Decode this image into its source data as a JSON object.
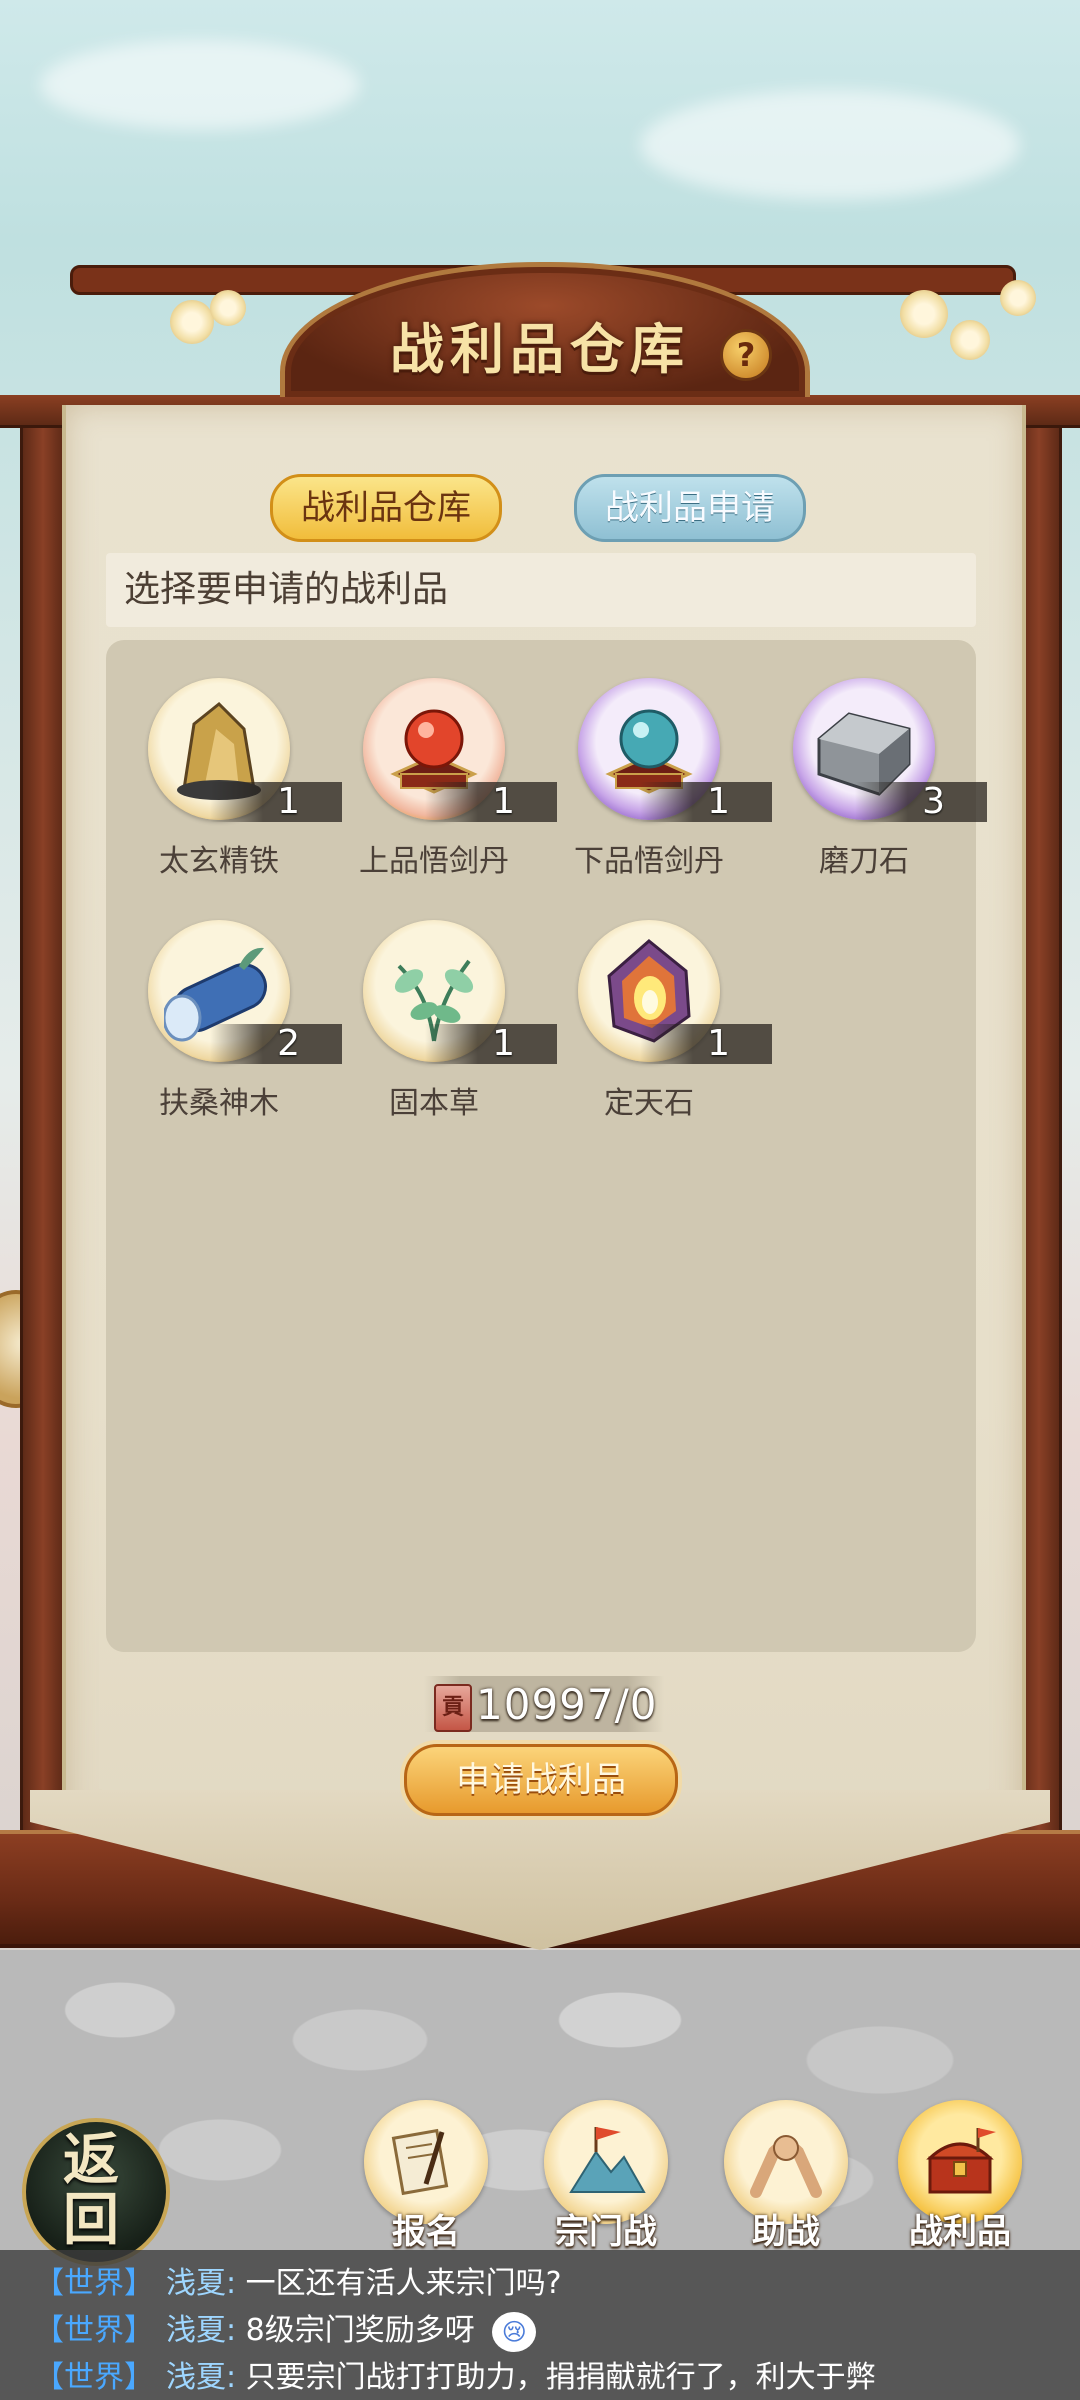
{
  "window": {
    "title": "战利品仓库",
    "help_symbol": "?"
  },
  "tabs": [
    {
      "label": "战利品仓库",
      "active": true
    },
    {
      "label": "战利品申请",
      "active": false
    }
  ],
  "prompt": "选择要申请的战利品",
  "items": [
    {
      "name": "太玄精铁",
      "count": "1",
      "icon": "ore-icon",
      "frame": "gold"
    },
    {
      "name": "上品悟剑丹",
      "count": "1",
      "icon": "red-pill-icon",
      "frame": "red"
    },
    {
      "name": "下品悟剑丹",
      "count": "1",
      "icon": "blue-pill-icon",
      "frame": "purple"
    },
    {
      "name": "磨刀石",
      "count": "3",
      "icon": "whetstone-icon",
      "frame": "purple"
    },
    {
      "name": "扶桑神木",
      "count": "2",
      "icon": "wood-log-icon",
      "frame": "gold"
    },
    {
      "name": "固本草",
      "count": "1",
      "icon": "herb-icon",
      "frame": "gold"
    },
    {
      "name": "定天石",
      "count": "1",
      "icon": "crystal-stone-icon",
      "frame": "gold"
    }
  ],
  "currency": {
    "icon_char": "貢",
    "value": "10997/0"
  },
  "apply_button": "申请战利品",
  "back_button": "返\n回",
  "nav": [
    {
      "label": "报名",
      "icon": "scroll-brush-icon",
      "active": false
    },
    {
      "label": "宗门战",
      "icon": "mountain-flag-icon",
      "active": false
    },
    {
      "label": "助战",
      "icon": "handshake-icon",
      "active": false
    },
    {
      "label": "战利品",
      "icon": "treasure-chest-icon",
      "active": true
    }
  ],
  "chat": [
    {
      "channel": "【世界】",
      "user": "浅夏:",
      "message": "一区还有活人来宗门吗?"
    },
    {
      "channel": "【世界】",
      "user": "浅夏:",
      "message": "8级宗门奖励多呀"
    },
    {
      "channel": "【世界】",
      "user": "浅夏:",
      "message": "只要宗门战打打助力，捐捐献就行了，利大于弊"
    }
  ],
  "colors": {
    "active_tab": "#f1bd3b",
    "inactive_tab": "#8fc0d3",
    "frame_wood": "#6b2d15",
    "chat_channel": "#4aa8ff"
  }
}
